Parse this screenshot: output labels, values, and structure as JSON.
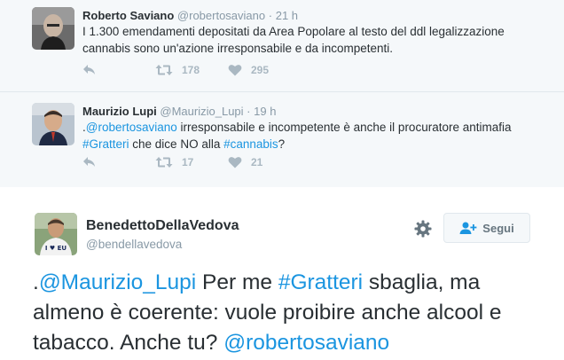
{
  "tweets": [
    {
      "name": "Roberto Saviano",
      "handle": "@robertosaviano",
      "dot": "·",
      "time": "21 h",
      "text": "I 1.300 emendamenti depositati da Area Popolare al testo del ddl legalizzazione cannabis sono un'azione irresponsabile e da incompetenti.",
      "retweets": "178",
      "likes": "295"
    },
    {
      "name": "Maurizio Lupi",
      "handle": "@Maurizio_Lupi",
      "dot": "·",
      "time": "19 h",
      "text_parts": [
        ".",
        "@robertosaviano",
        " irresponsabile e incompetente è anche il procuratore antimafia ",
        "#Gratteri",
        " che dice NO alla ",
        "#cannabis",
        "?"
      ],
      "retweets": "17",
      "likes": "21"
    }
  ],
  "main_tweet": {
    "name": "BenedettoDellaVedova",
    "handle": "@bendellavedova",
    "follow_label": "Segui",
    "text_parts": [
      ".",
      "@Maurizio_Lupi",
      " Per me ",
      "#Gratteri",
      " sbaglia, ma almeno è coerente: vuole proibire anche alcool e tabacco. Anche tu? ",
      "@robertosaviano"
    ],
    "avatar_badge": "I ♥ EU"
  },
  "icons": [
    "reply-icon",
    "retweet-icon",
    "heart-icon",
    "gear-icon",
    "follow-person-icon"
  ],
  "colors": {
    "link": "#1b95e0",
    "muted": "#8899a6",
    "icon": "#aab8c2",
    "thread_bg": "#f5f8fa"
  }
}
